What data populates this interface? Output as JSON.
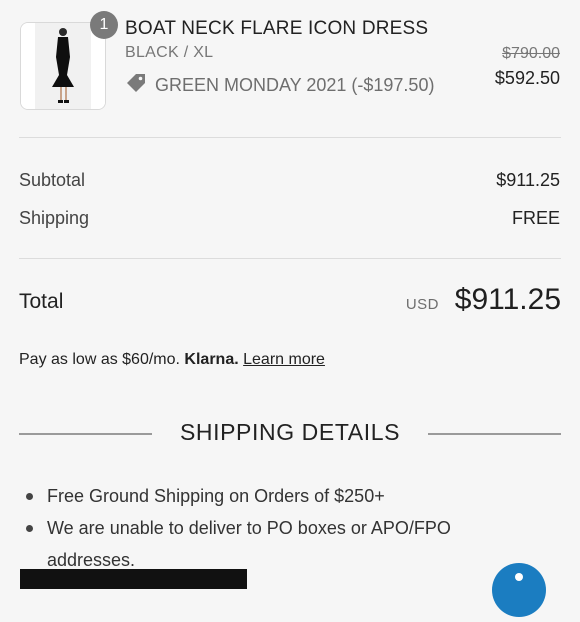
{
  "product": {
    "quantity": "1",
    "name": "BOAT NECK FLARE ICON DRESS",
    "variant": "BLACK / XL",
    "discount_label": "GREEN MONDAY 2021 (-$197.50)",
    "original_price": "$790.00",
    "sale_price": "$592.50"
  },
  "summary": {
    "subtotal_label": "Subtotal",
    "subtotal_value": "$911.25",
    "shipping_label": "Shipping",
    "shipping_value": "FREE",
    "total_label": "Total",
    "total_currency": "USD",
    "total_value": "$911.25"
  },
  "klarna": {
    "text": "Pay as low as $60/mo.",
    "brand": "Klarna.",
    "link": "Learn more"
  },
  "shipping_details": {
    "title": "SHIPPING DETAILS",
    "items": [
      "Free Ground Shipping on Orders of $250+",
      "We are unable to deliver to PO boxes or APO/FPO addresses."
    ]
  },
  "icons": {
    "discount": "tag-icon",
    "chat": "chat-icon"
  }
}
